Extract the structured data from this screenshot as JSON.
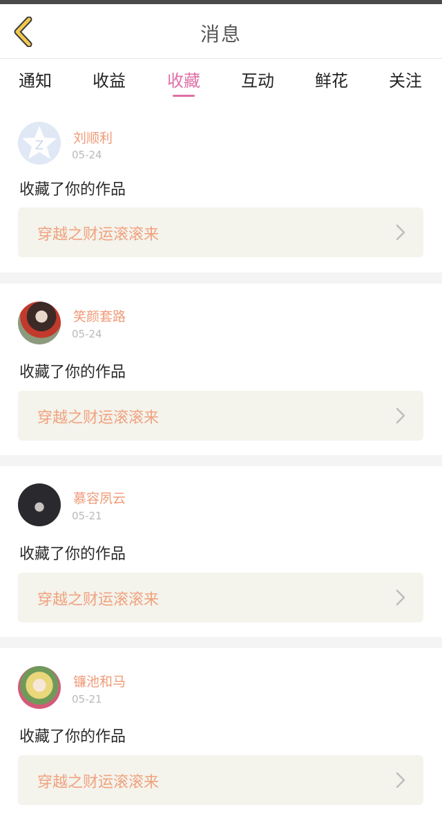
{
  "header": {
    "title": "消息"
  },
  "tabs": [
    {
      "label": "通知"
    },
    {
      "label": "收益"
    },
    {
      "label": "收藏"
    },
    {
      "label": "互动"
    },
    {
      "label": "鲜花"
    },
    {
      "label": "关注"
    }
  ],
  "active_tab": "收藏",
  "messages": [
    {
      "username": "刘顺利",
      "date": "05-24",
      "action": "收藏了你的作品",
      "work_title": "穿越之财运滚滚来",
      "avatar": "default-avatar-icon"
    },
    {
      "username": "笑颜套路",
      "date": "05-24",
      "action": "收藏了你的作品",
      "work_title": "穿越之财运滚滚来",
      "avatar": "user-photo-avatar"
    },
    {
      "username": "慕容夙云",
      "date": "05-21",
      "action": "收藏了你的作品",
      "work_title": "穿越之财运滚滚来",
      "avatar": "user-photo-avatar"
    },
    {
      "username": "镰池和马",
      "date": "05-21",
      "action": "收藏了你的作品",
      "work_title": "穿越之财运滚滚来",
      "avatar": "anime-avatar"
    }
  ],
  "colors": {
    "accent": "#e06fa6",
    "username": "#f09a78",
    "work_title": "#f0a27e",
    "work_box_bg": "#f4f3ec",
    "back_icon": "#f0c850"
  }
}
